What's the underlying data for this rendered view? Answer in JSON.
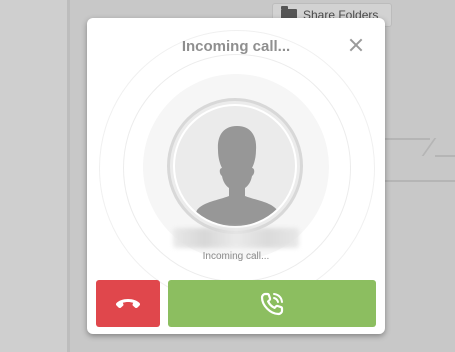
{
  "background": {
    "share_button_label": "Share Folders"
  },
  "dialog": {
    "title": "Incoming call...",
    "status": "Incoming call...",
    "close_icon": "close-icon",
    "avatar_icon": "user-silhouette-icon",
    "decline_icon": "phone-hangup-icon",
    "accept_icon": "phone-ringing-icon"
  },
  "colors": {
    "decline": "#e0474c",
    "accept": "#8cbe60"
  }
}
